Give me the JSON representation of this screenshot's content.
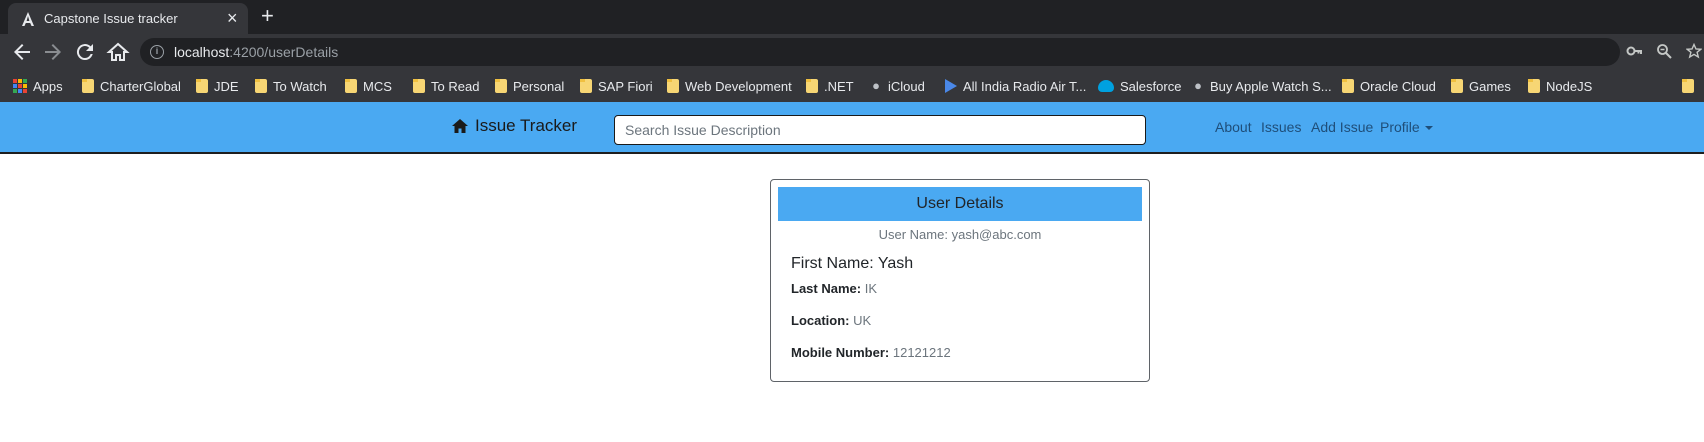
{
  "browser": {
    "tab_title": "Capstone Issue tracker",
    "tab_close": "×",
    "new_tab": "+",
    "url_host": "localhost",
    "url_rest": ":4200/userDetails",
    "bookmarks": [
      "Apps",
      "CharterGlobal",
      "JDE",
      "To Watch",
      "MCS",
      "To Read",
      "Personal",
      "SAP Fiori",
      "Web Development",
      ".NET",
      "iCloud",
      "All India Radio Air T...",
      "Salesforce",
      "Buy Apple Watch S...",
      "Oracle Cloud",
      "Games",
      "NodeJS"
    ]
  },
  "navbar": {
    "brand": "Issue Tracker",
    "search_placeholder": "Search Issue Description",
    "links": {
      "about": "About",
      "issues": "Issues",
      "add_issue": "Add Issue",
      "profile": "Profile"
    }
  },
  "user_card": {
    "header": "User Details",
    "user_name_label": "User Name:",
    "user_name": "yash@abc.com",
    "first_name_label": "First Name:",
    "first_name": "Yash",
    "last_name_label": "Last Name:",
    "last_name": "IK",
    "location_label": "Location:",
    "location": "UK",
    "mobile_label": "Mobile Number:",
    "mobile": "12121212"
  },
  "colors": {
    "navbar_bg": "#4aa9f2",
    "card_header_bg": "#4aa9f2",
    "chrome_dark": "#202124",
    "chrome_toolbar": "#35363a"
  }
}
